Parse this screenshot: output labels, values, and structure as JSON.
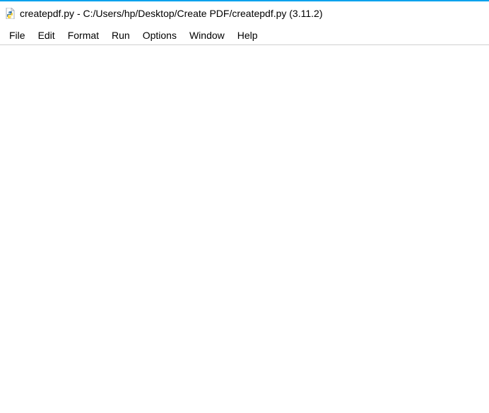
{
  "titlebar": {
    "title": "createpdf.py - C:/Users/hp/Desktop/Create PDF/createpdf.py (3.11.2)",
    "icon_name": "python-file-icon"
  },
  "menubar": {
    "items": [
      {
        "label": "File"
      },
      {
        "label": "Edit"
      },
      {
        "label": "Format"
      },
      {
        "label": "Run"
      },
      {
        "label": "Options"
      },
      {
        "label": "Window"
      },
      {
        "label": "Help"
      }
    ]
  },
  "editor": {
    "content": ""
  }
}
